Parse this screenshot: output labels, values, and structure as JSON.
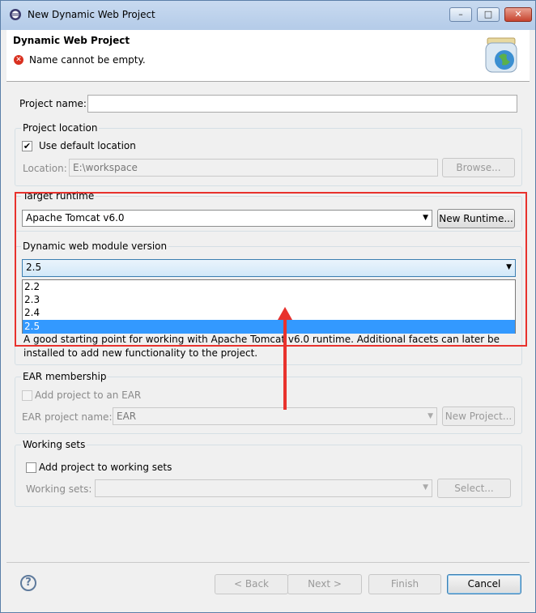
{
  "window": {
    "title": "New Dynamic Web Project",
    "min": "–",
    "max": "□",
    "close": "✕"
  },
  "header": {
    "title": "Dynamic Web Project",
    "error_message": "Name cannot be empty."
  },
  "project_name": {
    "label": "Project name:",
    "value": ""
  },
  "project_location": {
    "group_title": "Project location",
    "use_default_label": "Use default location",
    "use_default_checked": true,
    "location_label": "Location:",
    "location_value": "E:\\workspace",
    "browse_label": "Browse..."
  },
  "target_runtime": {
    "group_title": "Target runtime",
    "selected": "Apache Tomcat v6.0",
    "new_runtime_label": "New Runtime..."
  },
  "module_version": {
    "group_title": "Dynamic web module version",
    "selected": "2.5",
    "options": [
      "2.2",
      "2.3",
      "2.4",
      "2.5"
    ],
    "description": "A good starting point for working with Apache Tomcat v6.0 runtime. Additional facets can later be installed to add new functionality to the project."
  },
  "ear": {
    "group_title": "EAR membership",
    "add_label": "Add project to an EAR",
    "project_name_label": "EAR project name:",
    "project_name_value": "EAR",
    "new_project_label": "New Project..."
  },
  "working_sets": {
    "group_title": "Working sets",
    "add_label": "Add project to working sets",
    "sets_label": "Working sets:",
    "sets_value": "",
    "select_label": "Select..."
  },
  "footer": {
    "help": "?",
    "back": "< Back",
    "next": "Next >",
    "finish": "Finish",
    "cancel": "Cancel"
  },
  "colors": {
    "annotation": "#e8322d",
    "selection": "#3399ff"
  }
}
